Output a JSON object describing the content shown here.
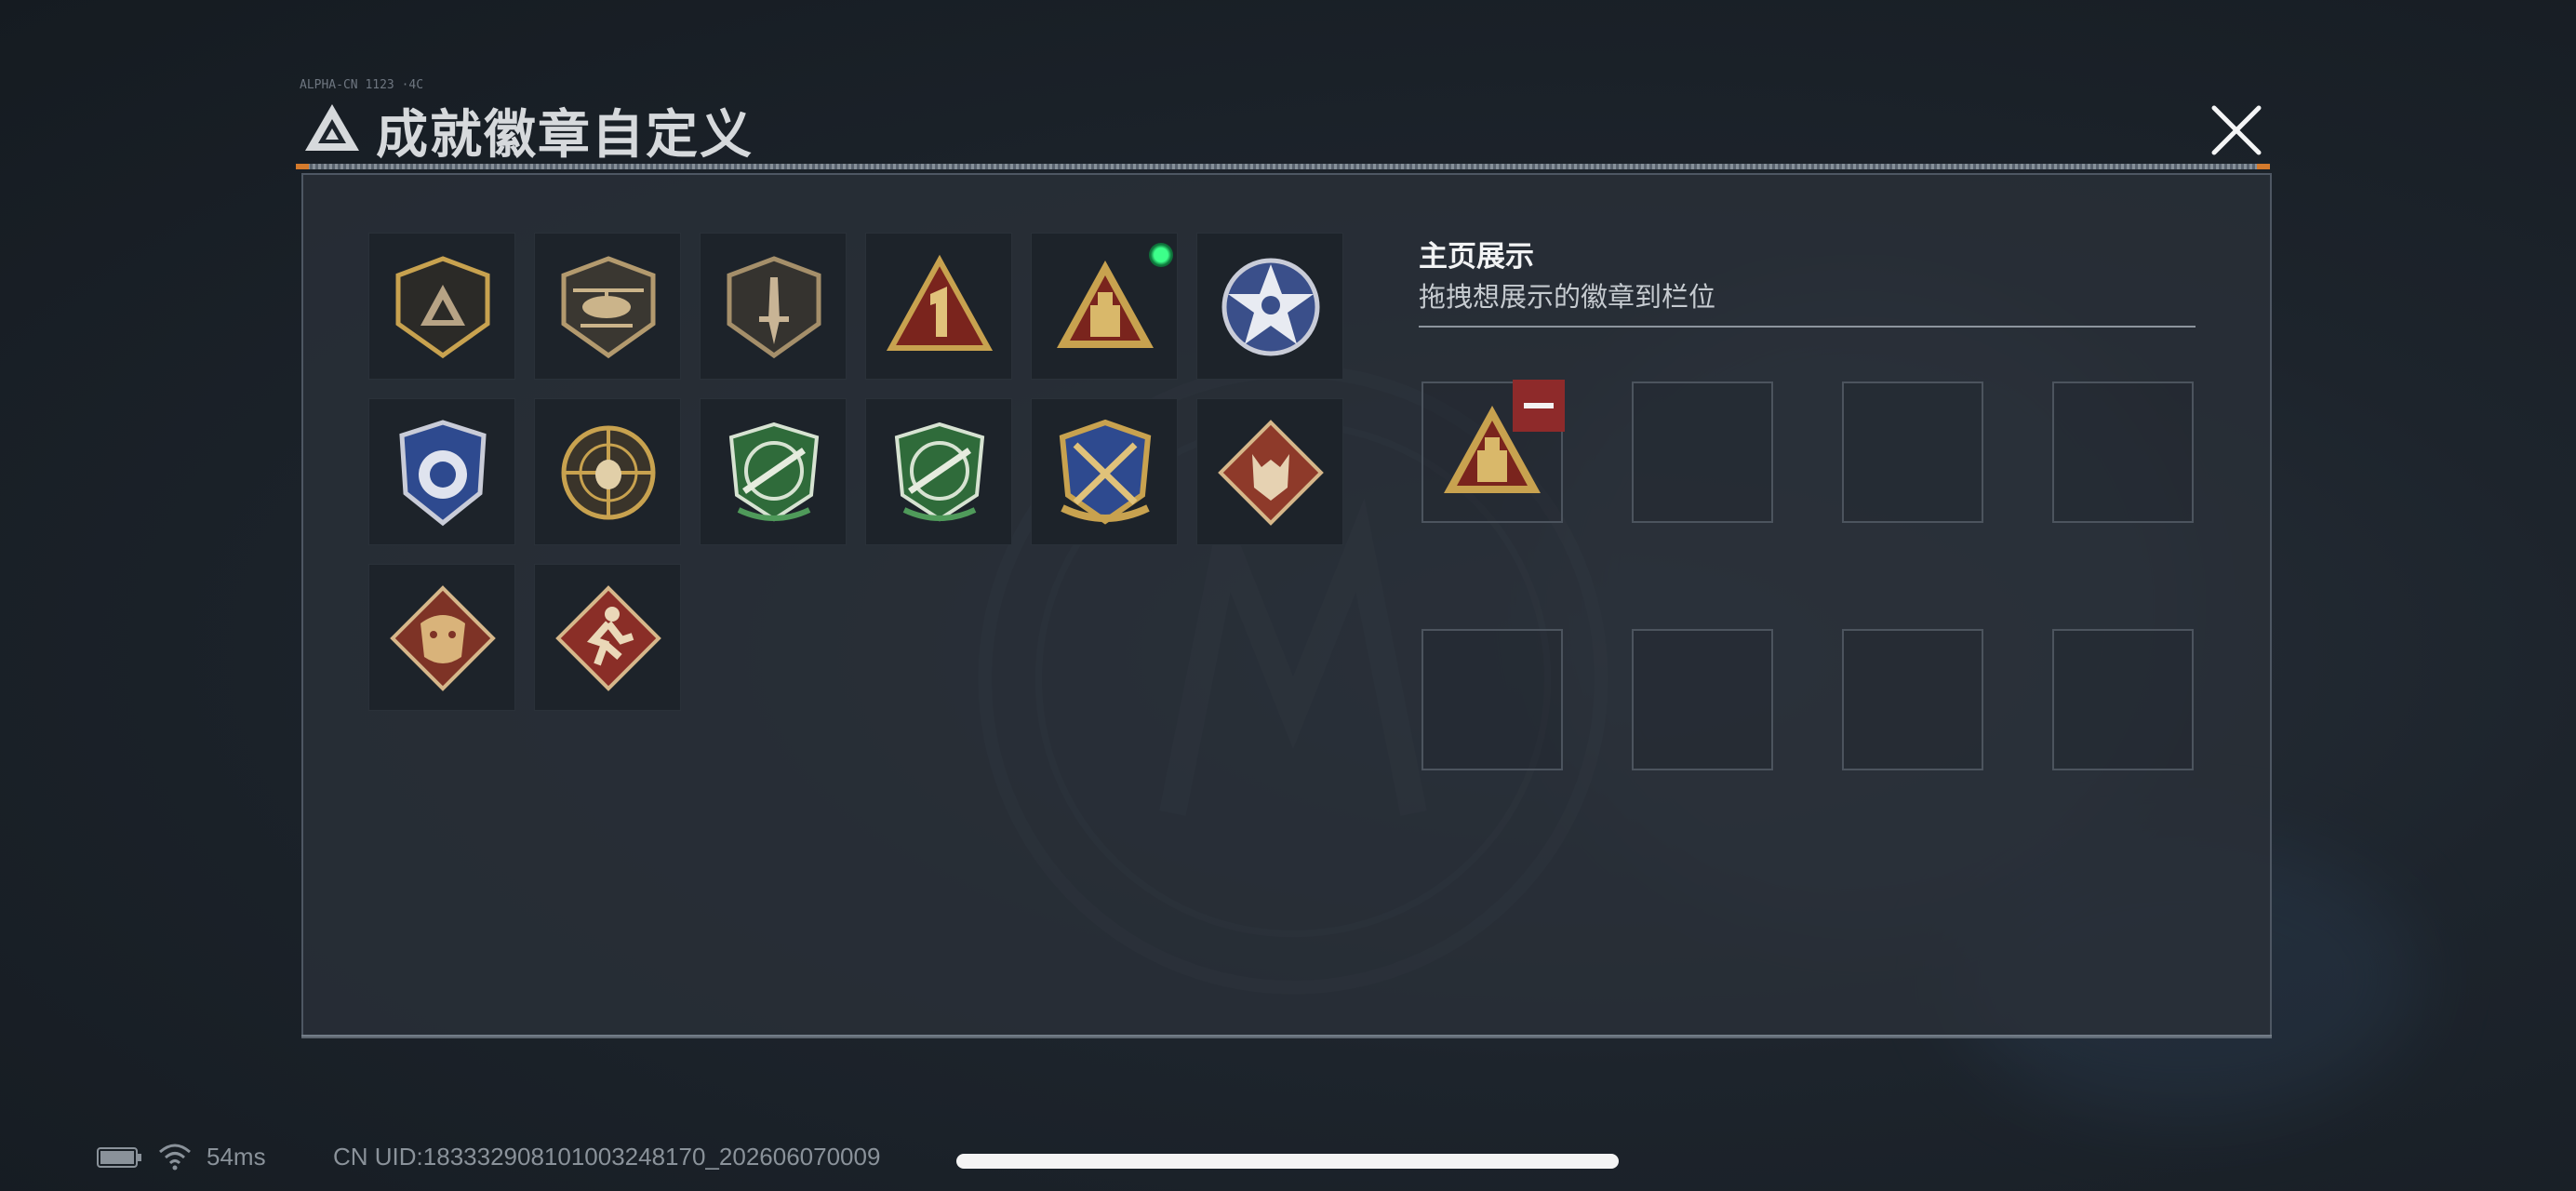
{
  "header": {
    "title": "成就徽章自定义",
    "tag": "ALPHA-CN 1123 ·4C",
    "logo_icon": "triangle-logo-icon",
    "close_icon": "close-icon"
  },
  "badges": [
    {
      "name": "badge-triangle-shield",
      "icon": "triangle-shield",
      "selected": false
    },
    {
      "name": "badge-helicopter",
      "icon": "helicopter-shield",
      "selected": false
    },
    {
      "name": "badge-knife",
      "icon": "knife-shield",
      "selected": false
    },
    {
      "name": "badge-number-one",
      "icon": "number-one-triangle",
      "selected": false
    },
    {
      "name": "badge-tower",
      "icon": "tower-triangle",
      "selected": true
    },
    {
      "name": "badge-star-skull",
      "icon": "star-skull",
      "selected": false
    },
    {
      "name": "badge-blue-crest",
      "icon": "blue-crest",
      "selected": false
    },
    {
      "name": "badge-sniper-skull",
      "icon": "sniper-skull",
      "selected": false
    },
    {
      "name": "badge-rifle-green-1",
      "icon": "rifle-green",
      "selected": false
    },
    {
      "name": "badge-rifle-green-2",
      "icon": "rifle-green",
      "selected": false
    },
    {
      "name": "badge-crossed-rifles",
      "icon": "crossed-rifles",
      "selected": false
    },
    {
      "name": "badge-wolf",
      "icon": "wolf-diamond",
      "selected": false
    },
    {
      "name": "badge-dragon",
      "icon": "dragon-diamond",
      "selected": false
    },
    {
      "name": "badge-runner",
      "icon": "runner-diamond",
      "selected": false
    }
  ],
  "showcase": {
    "title": "主页展示",
    "subtitle": "拖拽想展示的徽章到栏位",
    "slots": [
      {
        "filled": true,
        "badge": "tower-triangle"
      },
      {
        "filled": false
      },
      {
        "filled": false
      },
      {
        "filled": false
      },
      {
        "filled": false
      },
      {
        "filled": false
      },
      {
        "filled": false
      },
      {
        "filled": false
      }
    ],
    "remove_icon": "minus-icon"
  },
  "status_bar": {
    "latency": "54ms",
    "uid": "CN UID:18333290810100324817​0_202606070009",
    "battery_icon": "battery-icon",
    "wifi_icon": "wifi-icon"
  },
  "colors": {
    "panel": "#2a3038",
    "badge_gold": "#c8a24f",
    "badge_red": "#8e2d24",
    "badge_green": "#2f6b3a",
    "badge_blue": "#2e4a8f",
    "selected": "#3dff8a",
    "remove": "#8e2a2a"
  }
}
